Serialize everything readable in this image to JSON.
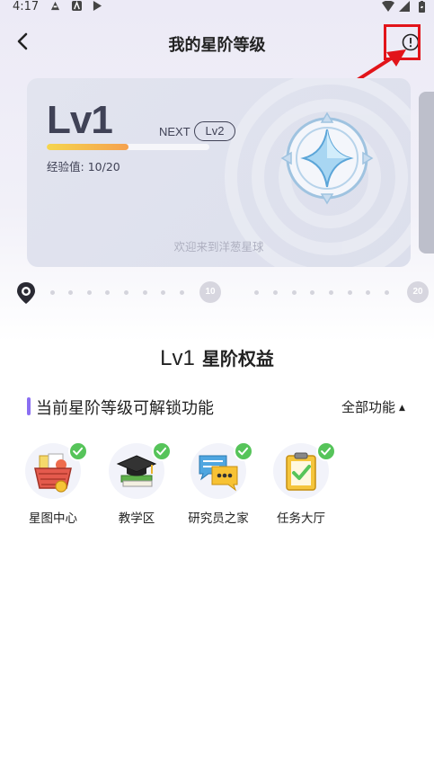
{
  "status_bar": {
    "time": "4:17"
  },
  "header": {
    "title": "我的星阶等级"
  },
  "level_card": {
    "level": "Lv1",
    "next_label": "NEXT",
    "next_level": "Lv2",
    "exp_label": "经验值:",
    "exp_value": "10/20",
    "progress": 0.5,
    "welcome": "欢迎来到洋葱星球"
  },
  "track": {
    "milestones": [
      "10",
      "20"
    ]
  },
  "benefits": {
    "level": "Lv1",
    "title": "星阶权益",
    "section_label": "当前星阶等级可解锁功能",
    "all_label": "全部功能",
    "features": [
      {
        "label": "星图中心",
        "icon": "basket-icon"
      },
      {
        "label": "教学区",
        "icon": "graduation-cap-icon"
      },
      {
        "label": "研究员之家",
        "icon": "chat-bubble-icon"
      },
      {
        "label": "任务大厅",
        "icon": "task-clipboard-icon"
      }
    ]
  },
  "colors": {
    "accent": "#8a6ef2",
    "highlight": "#e2141a",
    "check": "#56c45a"
  }
}
